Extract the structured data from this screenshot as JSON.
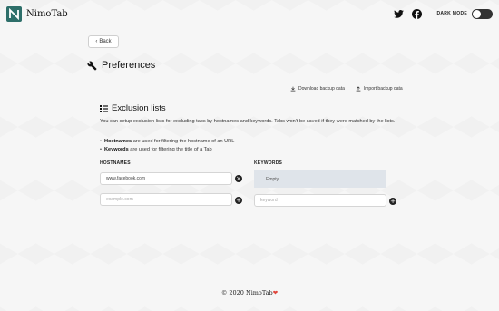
{
  "navbar": {
    "brand": "NimoTab",
    "twitter_icon": "twitter-icon",
    "facebook_icon": "facebook-icon",
    "dark_mode_label": "DARK MODE",
    "dark_mode_on": false
  },
  "back_button": {
    "label": "Back"
  },
  "page": {
    "title": "Preferences"
  },
  "backup": {
    "download_label": "Download backup data",
    "import_label": "Import backup data"
  },
  "exclusion": {
    "title": "Exclusion lists",
    "description": "You can setup exclusion lists for excluding tabs by hostnames and keywords. Tabs won't be saved if they were matched by the lists.",
    "bullets": [
      {
        "bold": "Hostnames",
        "text": "are used for filtering the hostname of an URL"
      },
      {
        "bold": "Keywords",
        "text": "are used for filtering the title of a Tab"
      }
    ],
    "hostnames": {
      "header": "HOSTNAMES",
      "entries": [
        "www.facebook.com"
      ],
      "input_placeholder": "example.com"
    },
    "keywords": {
      "header": "KEYWORDS",
      "empty_label": "Empty",
      "input_placeholder": "keyword"
    }
  },
  "footer": {
    "text": "© 2020 NimoTab",
    "heart": "❤",
    "heart_color": "#e0463d"
  },
  "colors": {
    "logo_bg": "#2e6f6a",
    "empty_box_bg": "#dfe4ea"
  }
}
